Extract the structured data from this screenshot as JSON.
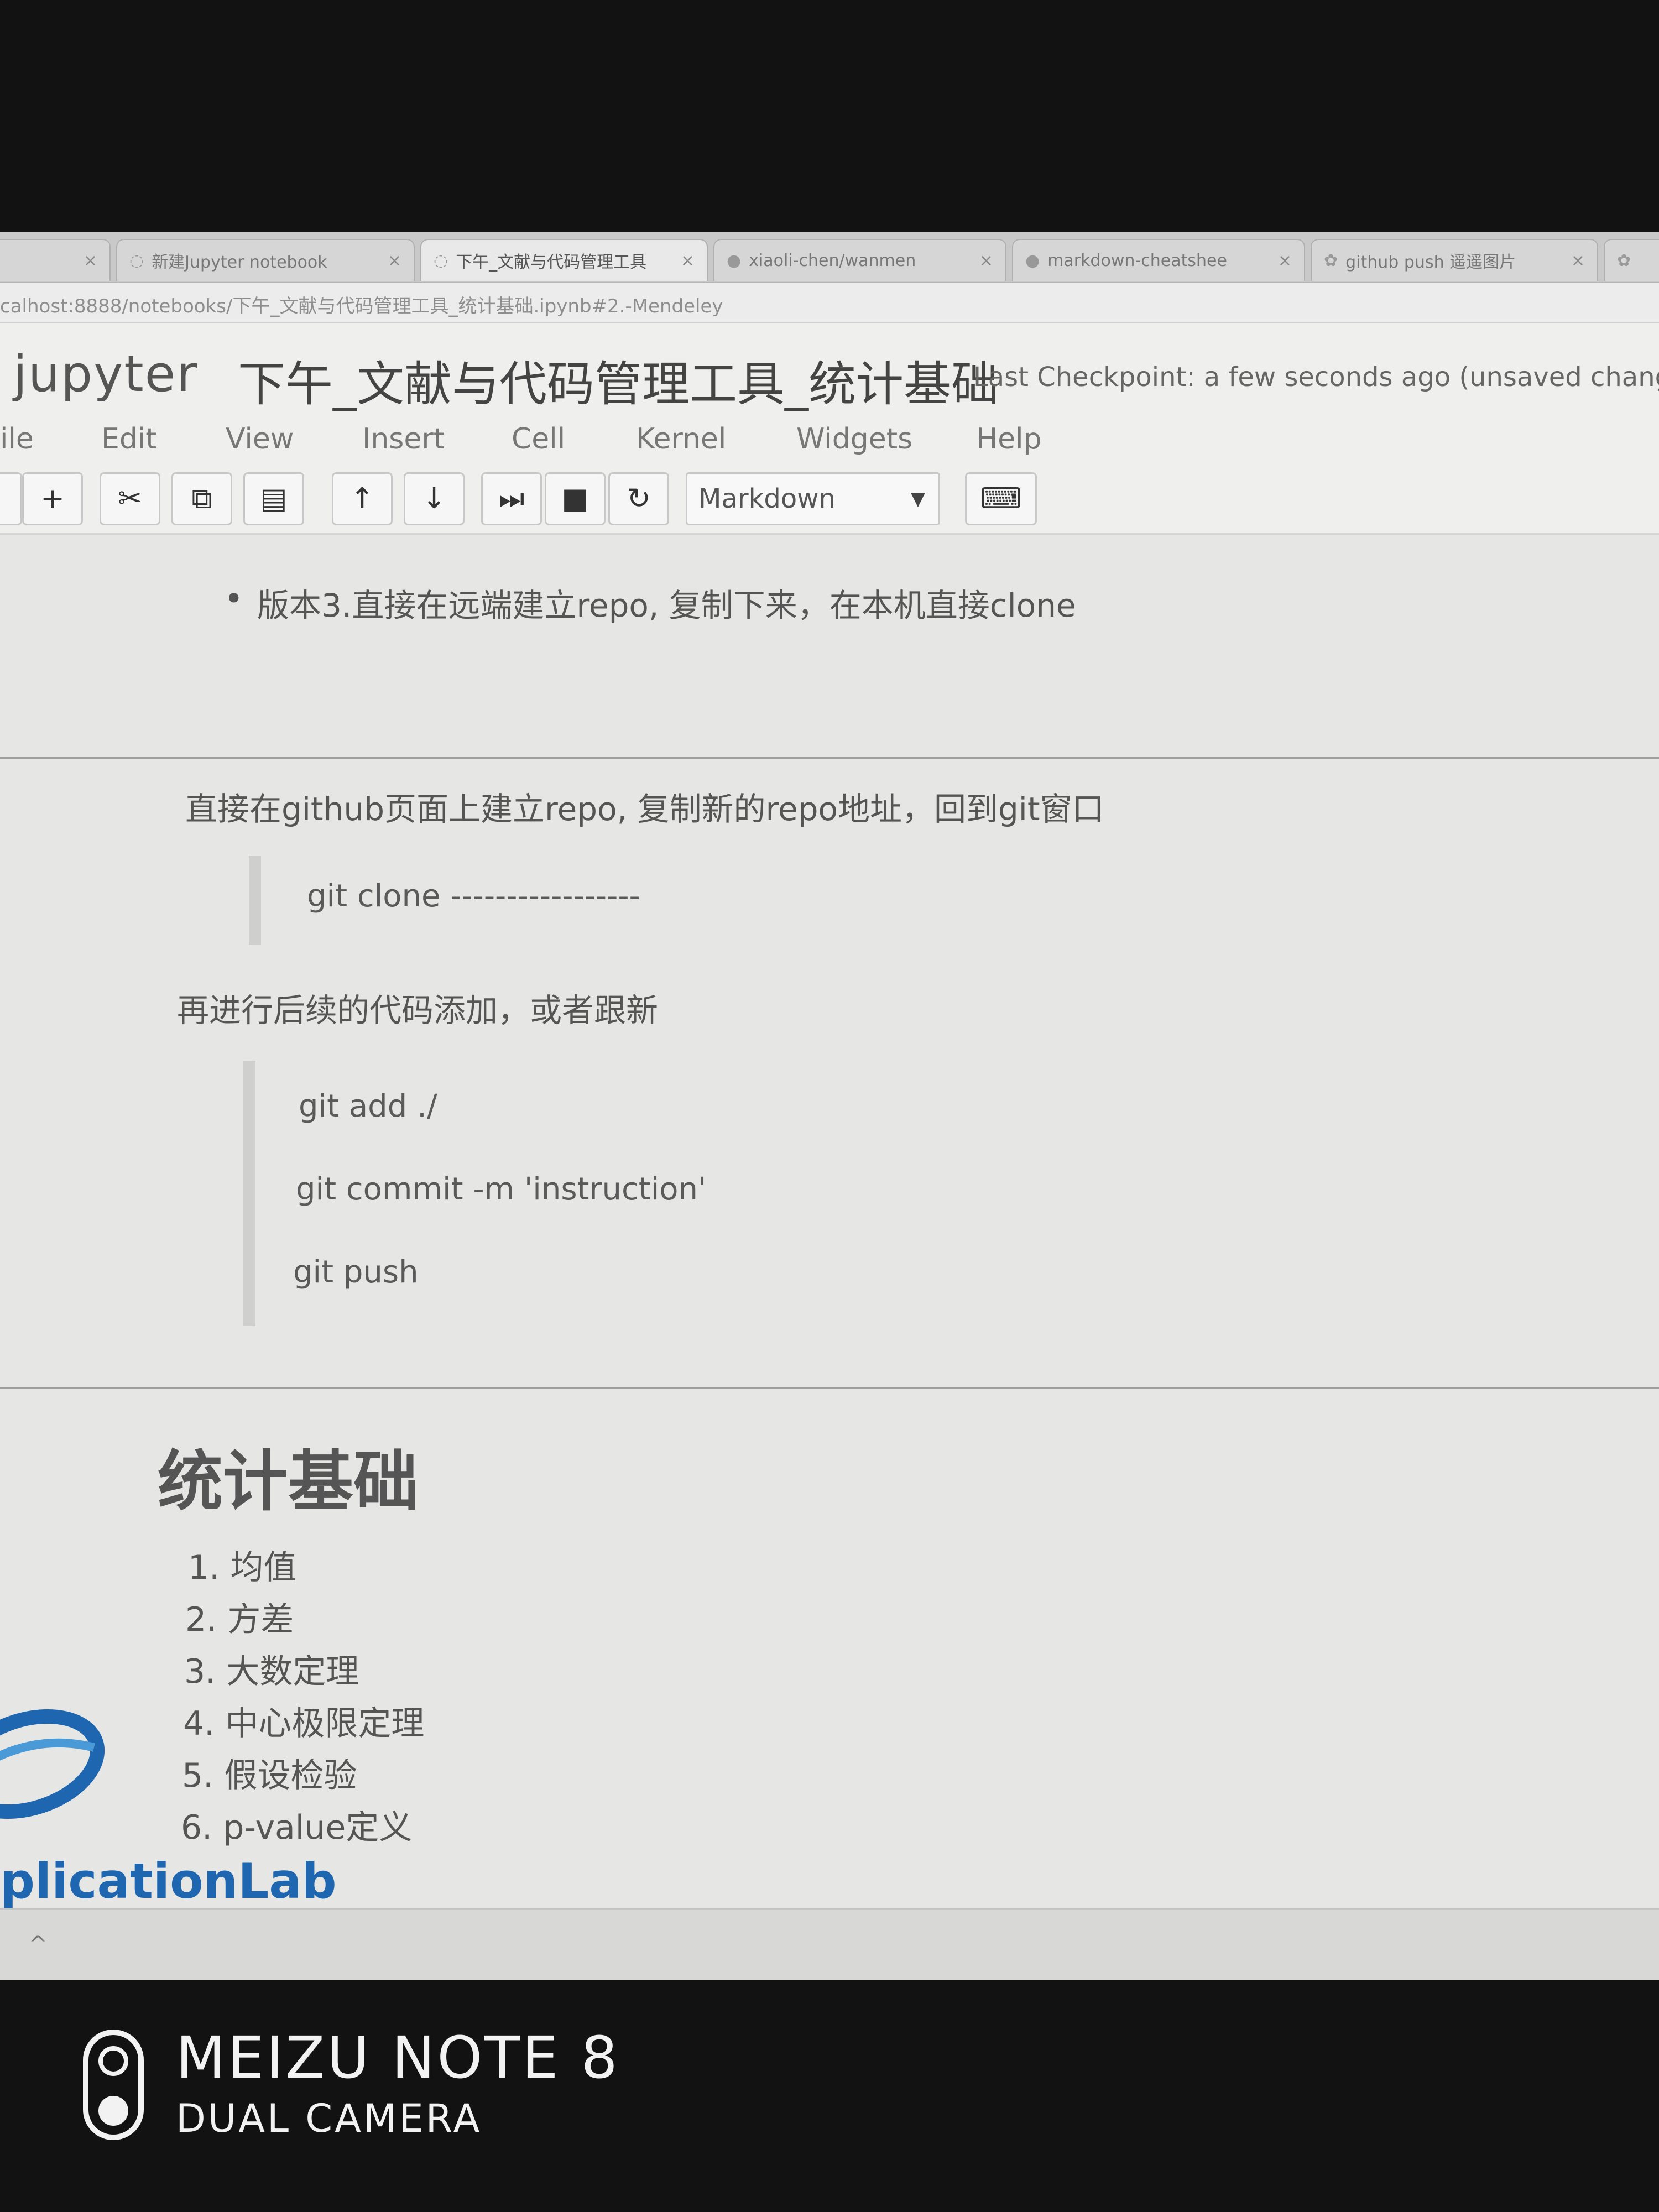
{
  "browser": {
    "tabs": [
      {
        "label": "",
        "active": false
      },
      {
        "label": "新建Jupyter notebook",
        "active": false
      },
      {
        "label": "下午_文献与代码管理工具",
        "active": true
      },
      {
        "label": "xiaoli-chen/wanmen",
        "active": false
      },
      {
        "label": "markdown-cheatshee",
        "active": false
      },
      {
        "label": "github push 遥遥图片",
        "active": false
      }
    ],
    "url": "calhost:8888/notebooks/下午_文献与代码管理工具_统计基础.ipynb#2.-Mendeley"
  },
  "header": {
    "logo": "jupyter",
    "notebook_title": "下午_文献与代码管理工具_统计基础",
    "checkpoint": "Last Checkpoint: a few seconds ago (unsaved chang"
  },
  "menu": [
    "ile",
    "Edit",
    "View",
    "Insert",
    "Cell",
    "Kernel",
    "Widgets",
    "Help"
  ],
  "toolbar": {
    "cell_type": "Markdown"
  },
  "cells": {
    "bullet": "版本3.直接在远端建立repo, 复制下来，在本机直接clone",
    "para1": "直接在github页面上建立repo, 复制新的repo地址，回到git窗口",
    "code1": "git clone -----------------",
    "para2": "再进行后续的代码添加，或者跟新",
    "code2": [
      "git add ./",
      "git commit -m 'instruction'",
      "git push"
    ],
    "heading": "统计基础",
    "list": [
      "1. 均值",
      "2. 方差",
      "3. 大数定理",
      "4. 中心极限定理",
      "5. 假设检验",
      "6. p-value定义"
    ]
  },
  "overlay": {
    "lab_text": "plicationLab"
  },
  "watermark": {
    "model": "MEIZU NOTE 8",
    "camera": "DUAL CAMERA"
  },
  "colors": {
    "accent_blue": "#1e67b0"
  }
}
